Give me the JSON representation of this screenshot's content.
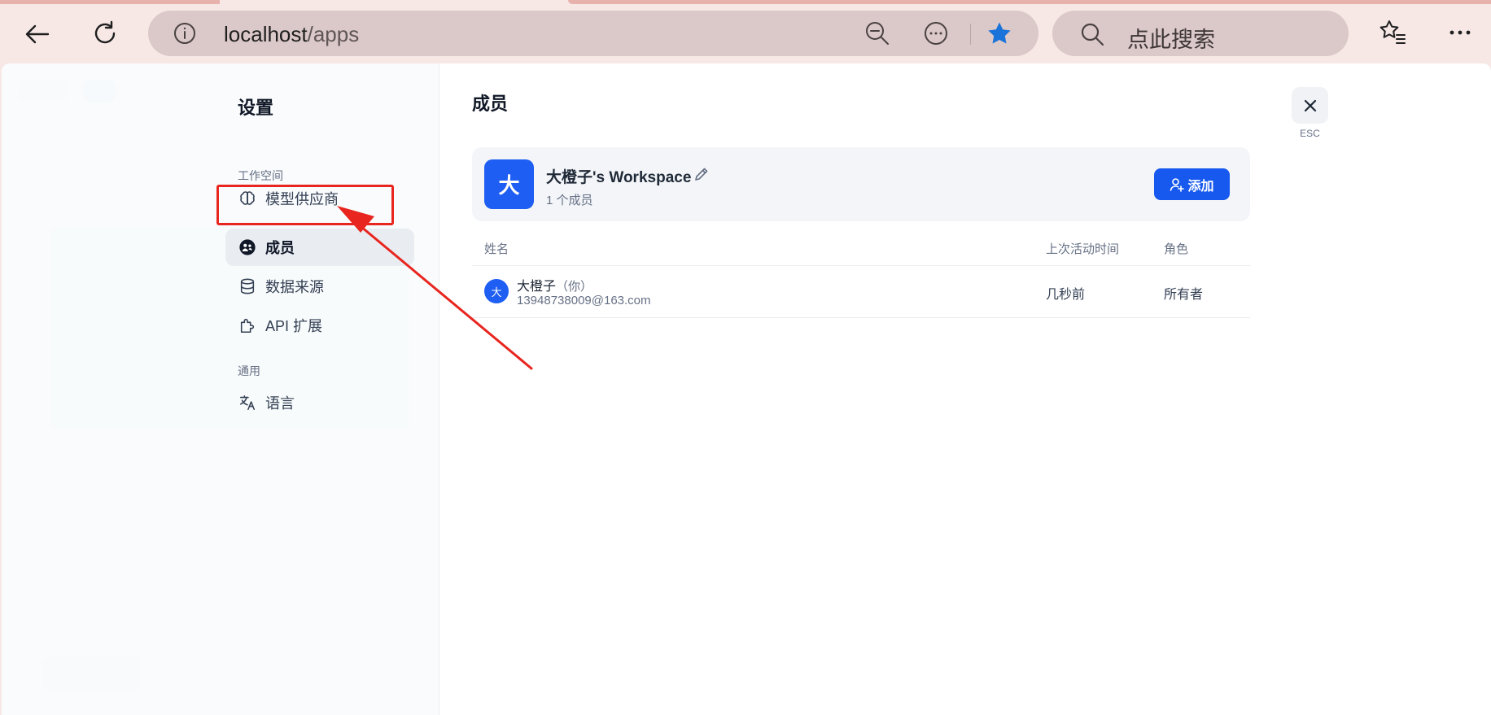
{
  "browser": {
    "address_host": "localhost",
    "address_path": "/apps",
    "search_placeholder": "点此搜索"
  },
  "settings": {
    "title": "设置",
    "sections": {
      "workspace": "工作空间",
      "general": "通用"
    },
    "nav": {
      "model_provider": "模型供应商",
      "members": "成员",
      "data_source": "数据来源",
      "api_extension": "API 扩展",
      "language": "语言"
    },
    "active_item": "members"
  },
  "members_page": {
    "title": "成员",
    "workspace": {
      "avatar_letter": "大",
      "name": "大橙子's Workspace",
      "member_count": "1 个成员"
    },
    "add_button_label": "添加",
    "columns": {
      "name": "姓名",
      "last_active": "上次活动时间",
      "role": "角色"
    },
    "rows": [
      {
        "avatar_letter": "大",
        "name": "大橙子",
        "you_tag": "（你）",
        "email": "13948738009@163.com",
        "last_active": "几秒前",
        "role": "所有者"
      }
    ]
  },
  "close": {
    "esc_label": "ESC"
  },
  "colors": {
    "accent": "#1759ee",
    "annotation": "#e8251e",
    "browser_chrome": "#f7e8e6"
  }
}
